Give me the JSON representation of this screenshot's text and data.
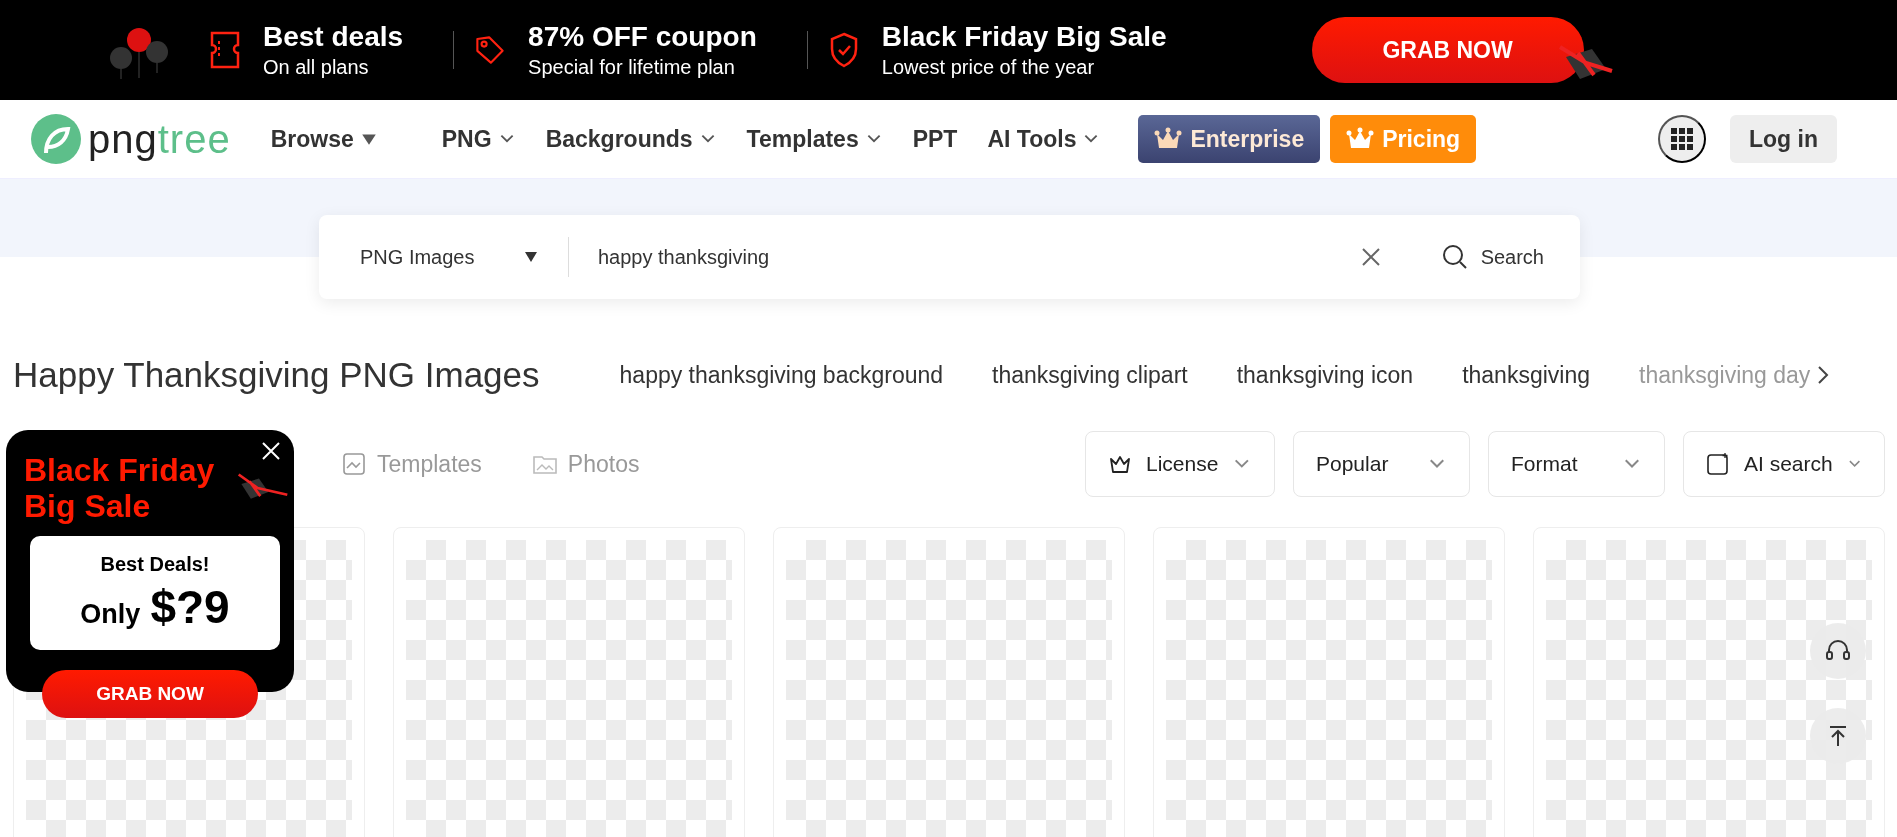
{
  "promo_bar": {
    "items": [
      {
        "title": "Best deals",
        "subtitle": "On all plans"
      },
      {
        "title": "87% OFF coupon",
        "subtitle": "Special for lifetime plan"
      },
      {
        "title": "Black Friday Big Sale",
        "subtitle": "Lowest price of the year"
      }
    ],
    "button": "GRAB NOW"
  },
  "nav": {
    "logo": {
      "text": "png",
      "accent": "tree"
    },
    "menu": [
      {
        "label": "Browse",
        "kind": "triangle"
      },
      {
        "label": "PNG",
        "kind": "chevron"
      },
      {
        "label": "Backgrounds",
        "kind": "chevron"
      },
      {
        "label": "Templates",
        "kind": "chevron"
      },
      {
        "label": "PPT",
        "kind": "plain"
      },
      {
        "label": "AI Tools",
        "kind": "chevron"
      }
    ],
    "buttons": [
      {
        "label": "Enterprise",
        "kind": "enterprise"
      },
      {
        "label": "Pricing",
        "kind": "pricing"
      }
    ],
    "login": "Log in"
  },
  "search": {
    "category": "PNG Images",
    "value": "happy thanksgiving",
    "button": "Search"
  },
  "results": {
    "title": "Happy Thanksgiving PNG Images",
    "related": [
      "happy thanksgiving background",
      "thanksgiving clipart",
      "thanksgiving icon",
      "thanksgiving",
      "thanksgiving day"
    ],
    "type_tabs": [
      {
        "label": "Templates"
      },
      {
        "label": "Photos"
      }
    ],
    "filters": [
      {
        "label": "License",
        "kind": "crown"
      },
      {
        "label": "Popular",
        "kind": "plain"
      },
      {
        "label": "Format",
        "kind": "plain"
      },
      {
        "label": "AI search",
        "kind": "ai"
      }
    ]
  },
  "popup": {
    "title": "Black Friday Big Sale",
    "deal": "Best Deals!",
    "price_prefix": "Only",
    "price": "$?9",
    "button": "GRAB NOW"
  }
}
